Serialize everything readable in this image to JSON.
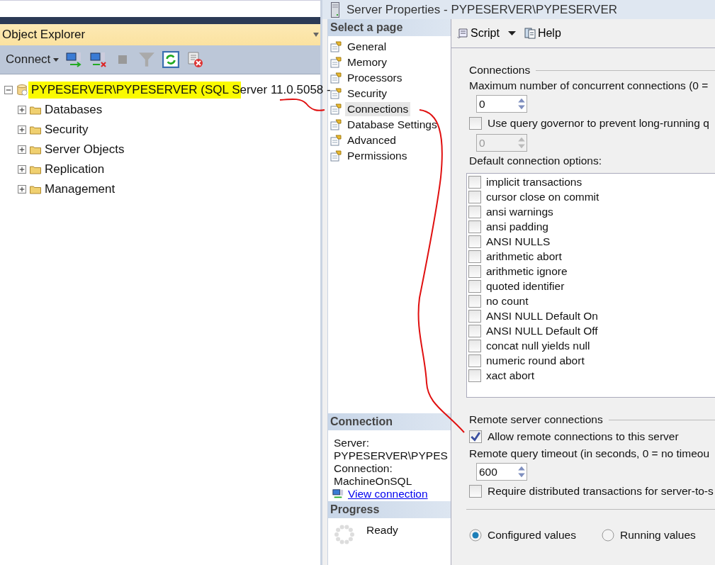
{
  "object_explorer": {
    "title": "Object Explorer",
    "connect": "Connect",
    "tree": {
      "label": "PYPESERVER\\PYPESERVER (SQL Server 11.0.5058 -",
      "expanded": true,
      "highlighted": true,
      "children": [
        {
          "label": "Databases",
          "expanded": false
        },
        {
          "label": "Security",
          "expanded": false
        },
        {
          "label": "Server Objects",
          "expanded": false
        },
        {
          "label": "Replication",
          "expanded": false
        },
        {
          "label": "Management",
          "expanded": false
        }
      ]
    }
  },
  "dialog": {
    "title": "Server Properties - PYPESERVER\\PYPESERVER",
    "select_heading": "Select a page",
    "pages": [
      {
        "label": "General",
        "selected": false
      },
      {
        "label": "Memory",
        "selected": false
      },
      {
        "label": "Processors",
        "selected": false
      },
      {
        "label": "Security",
        "selected": false
      },
      {
        "label": "Connections",
        "selected": true
      },
      {
        "label": "Database Settings",
        "selected": false
      },
      {
        "label": "Advanced",
        "selected": false
      },
      {
        "label": "Permissions",
        "selected": false
      }
    ],
    "connection": {
      "heading": "Connection",
      "server_label": "Server:",
      "server_value": "PYPESERVER\\PYPES",
      "connection_label": "Connection:",
      "connection_value": "MachineOnSQL",
      "link": "View connection"
    },
    "progress": {
      "heading": "Progress",
      "status": "Ready"
    },
    "toolbar": {
      "script": "Script",
      "help": "Help"
    },
    "connections": {
      "legend": "Connections",
      "max_label": "Maximum number of concurrent connections (0 =",
      "max_value": "0",
      "governor": {
        "label": "Use query governor to prevent long-running q",
        "checked": false
      },
      "governor_value": {
        "value": "0",
        "disabled": true
      },
      "options_label": "Default connection options:",
      "options": [
        {
          "label": "implicit transactions",
          "checked": false
        },
        {
          "label": "cursor close on commit",
          "checked": false
        },
        {
          "label": "ansi warnings",
          "checked": false
        },
        {
          "label": "ansi padding",
          "checked": false
        },
        {
          "label": "ANSI NULLS",
          "checked": false
        },
        {
          "label": "arithmetic abort",
          "checked": false
        },
        {
          "label": "arithmetic ignore",
          "checked": false
        },
        {
          "label": "quoted identifier",
          "checked": false
        },
        {
          "label": "no count",
          "checked": false
        },
        {
          "label": "ANSI NULL Default On",
          "checked": false
        },
        {
          "label": "ANSI NULL Default Off",
          "checked": false
        },
        {
          "label": "concat null yields null",
          "checked": false
        },
        {
          "label": "numeric round abort",
          "checked": false
        },
        {
          "label": "xact abort",
          "checked": false
        }
      ]
    },
    "remote": {
      "legend": "Remote server connections",
      "allow": {
        "label": "Allow remote connections to this server",
        "checked": true
      },
      "timeout_label": "Remote query timeout (in seconds, 0 = no timeou",
      "timeout_value": "600",
      "distributed": {
        "label": "Require distributed transactions for server-to-s",
        "checked": false
      }
    },
    "view_modes": [
      {
        "label": "Configured values",
        "selected": true
      },
      {
        "label": "Running values",
        "selected": false
      }
    ]
  }
}
